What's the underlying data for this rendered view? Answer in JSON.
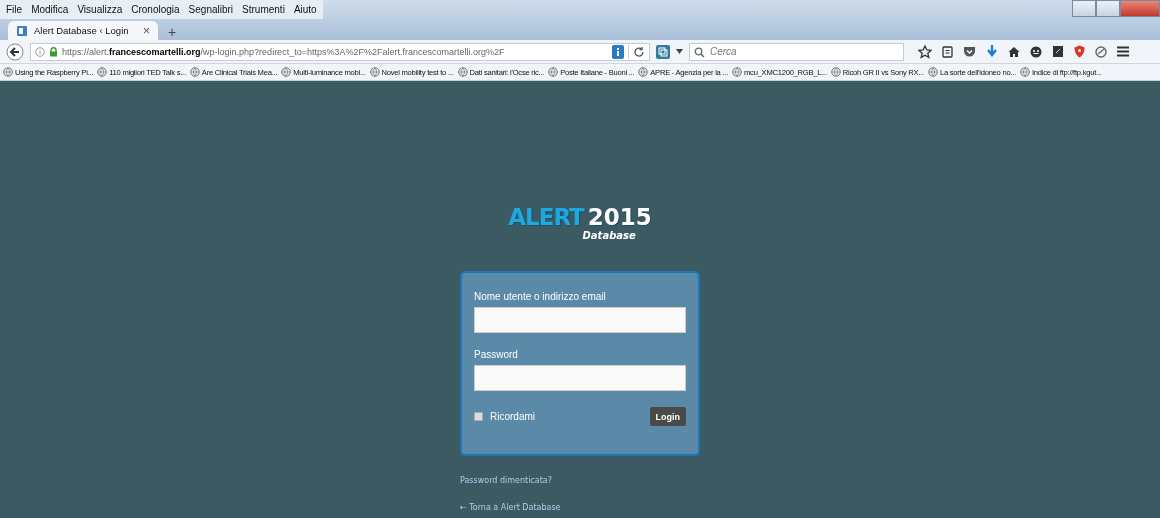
{
  "menu_bar": [
    "File",
    "Modifica",
    "Visualizza",
    "Cronologia",
    "Segnalibri",
    "Strumenti",
    "Aiuto"
  ],
  "tabs": [
    {
      "label": "Alert Database ‹ Login",
      "selected": true,
      "close": "×"
    }
  ],
  "new_tab": "+",
  "address_bar": {
    "url": "https://alert.**francescomartelli.org**/wp-login.php?redirect_to=https%3A%2F%2Falert.francescomartelli.org%2F"
  },
  "search": {
    "placeholder": "Cerca"
  },
  "bookmarks": [
    {
      "label": "Using the Raspberry Pi..."
    },
    {
      "label": "110 migliori TED Talk s..."
    },
    {
      "label": "Are Clinical Trials Mea..."
    },
    {
      "label": "Multi-luminance mobi..."
    },
    {
      "label": "Novel mobility test to ..."
    },
    {
      "label": "Dati sanitari: l'Ocse ric..."
    },
    {
      "label": "Poste Italiane - Buoni ..."
    },
    {
      "label": "APRE - Agenzia per la ..."
    },
    {
      "label": "mcu_XMC1200_RGB_L..."
    },
    {
      "label": "Ricoh GR II vs Sony RX..."
    },
    {
      "label": "La sorte dell'idoneo no..."
    },
    {
      "label": "Indice di ftp://ftp.kgut..."
    }
  ],
  "logo": {
    "word": "ALERT",
    "year": "2015",
    "subtitle": "Database"
  },
  "login_form": {
    "username_label": "Nome utente o indirizzo email",
    "password_label": "Password",
    "remember_label": "Ricordami",
    "remember_checked": false,
    "submit": "Login"
  },
  "links": [
    "Password dimenticata?",
    "← Torna a Alert Database"
  ]
}
